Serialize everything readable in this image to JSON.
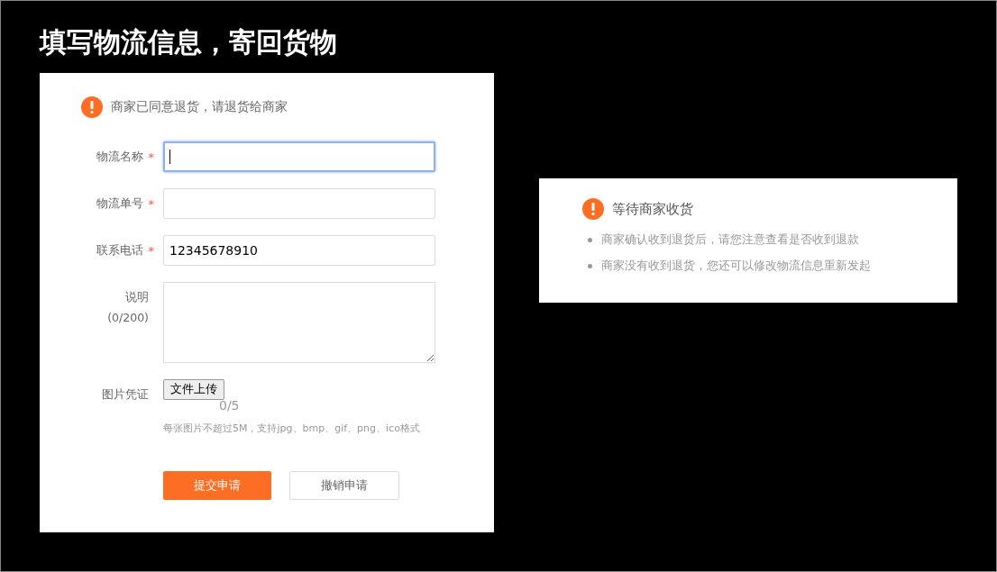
{
  "title": "填写物流信息，寄回货物",
  "form_card": {
    "notice": "商家已同意退货，请退货给商家",
    "fields": [
      {
        "kind": "text",
        "label": "物流名称",
        "required_mark": "*",
        "focused": true
      },
      {
        "kind": "text",
        "label": "物流单号",
        "required_mark": "*",
        "focused": false
      },
      {
        "kind": "text",
        "label": "联系电话",
        "required_mark": "*",
        "focused": false,
        "value": "12345678910"
      },
      {
        "kind": "textarea",
        "label": "说明",
        "counter": "(0/200)"
      },
      {
        "kind": "file",
        "label": "图片凭证",
        "button": "文件上传",
        "count": "0/5",
        "hint": "每张图片不超过5M，支持jpg、bmp、gif、png、ico格式"
      }
    ],
    "buttons": [
      {
        "label": "提交申请",
        "kind": "primary"
      },
      {
        "label": "撤销申请",
        "kind": "secondary"
      }
    ]
  },
  "status_card": {
    "title": "等待商家收货",
    "notes": [
      "商家确认收到退货后，请您注意查看是否收到退款",
      "商家没有收到退货，您还可以修改物流信息重新发起"
    ]
  }
}
